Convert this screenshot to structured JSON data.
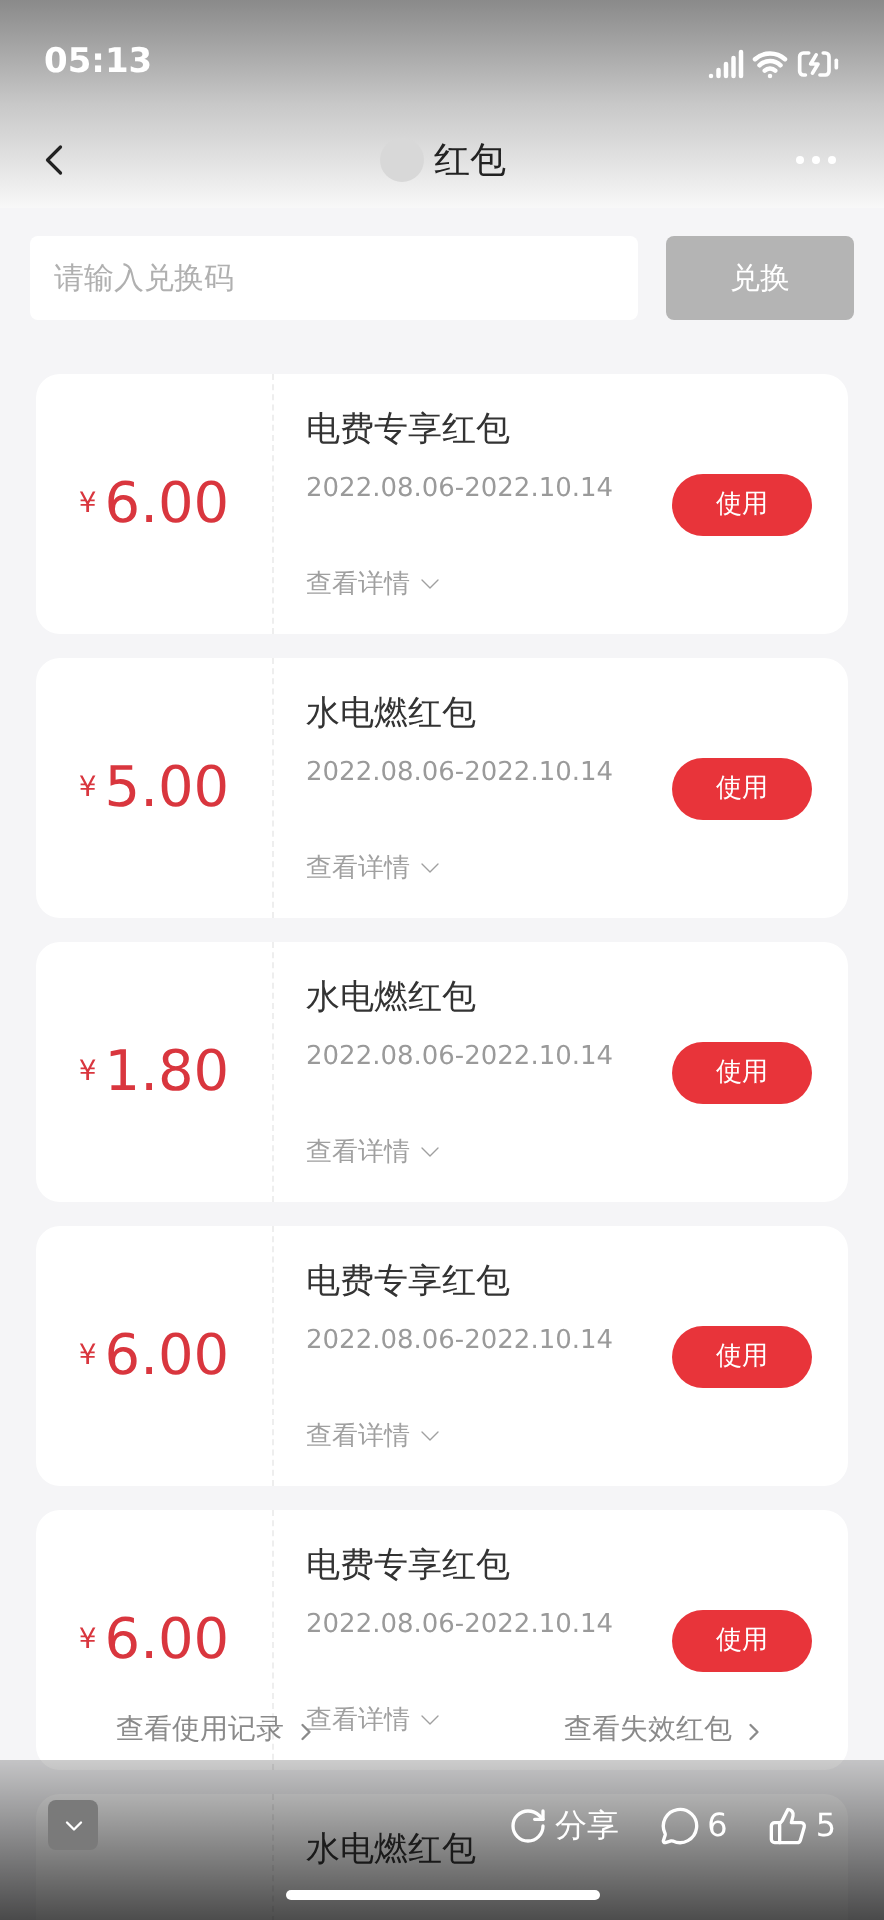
{
  "status_bar": {
    "time": "05:13"
  },
  "nav": {
    "title": "红包"
  },
  "redeem": {
    "placeholder": "请输入兑换码",
    "button": "兑换"
  },
  "coupons": [
    {
      "currency": "¥",
      "amount": "6.00",
      "title": "电费专享红包",
      "validity": "2022.08.06-2022.10.14",
      "action": "使用",
      "details": "查看详情"
    },
    {
      "currency": "¥",
      "amount": "5.00",
      "title": "水电燃红包",
      "validity": "2022.08.06-2022.10.14",
      "action": "使用",
      "details": "查看详情"
    },
    {
      "currency": "¥",
      "amount": "1.80",
      "title": "水电燃红包",
      "validity": "2022.08.06-2022.10.14",
      "action": "使用",
      "details": "查看详情"
    },
    {
      "currency": "¥",
      "amount": "6.00",
      "title": "电费专享红包",
      "validity": "2022.08.06-2022.10.14",
      "action": "使用",
      "details": "查看详情"
    },
    {
      "currency": "¥",
      "amount": "6.00",
      "title": "电费专享红包",
      "validity": "2022.08.06-2022.10.14",
      "action": "使用",
      "details": "查看详情"
    },
    {
      "title": "水电燃红包"
    }
  ],
  "links": [
    {
      "label": "查看使用记录"
    },
    {
      "label": "查看失效红包"
    }
  ],
  "post_bar": {
    "share": "分享",
    "comments": "6",
    "likes": "5"
  }
}
